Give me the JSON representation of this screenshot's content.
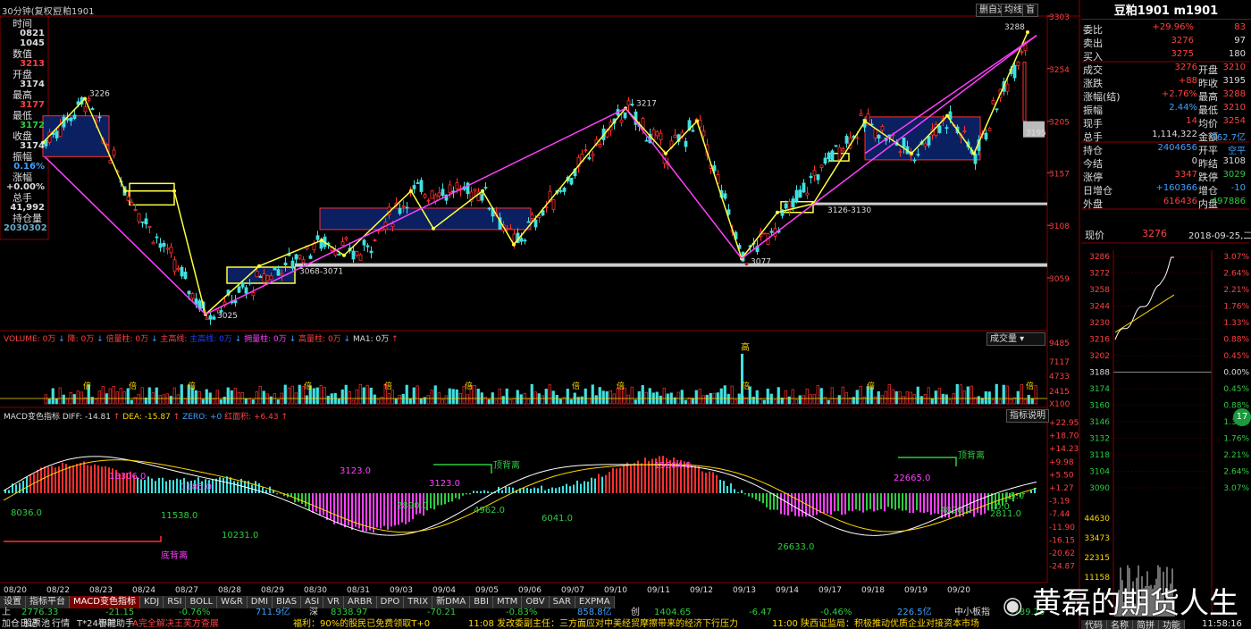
{
  "top_bar": {
    "period": "30分钟(复权)",
    "symbol": "豆粕1901",
    "buttons": [
      "删自选",
      "均线",
      "盲"
    ]
  },
  "left_panel": [
    {
      "label": "时间",
      "value": "0821",
      "vcolor": "#ddd"
    },
    {
      "label": "",
      "value": "1045",
      "vcolor": "#ddd"
    },
    {
      "label": "数值",
      "value": "3213",
      "vcolor": "#ff4040"
    },
    {
      "label": "开盘",
      "value": "3174",
      "vcolor": "#ddd"
    },
    {
      "label": "最高",
      "value": "3177",
      "vcolor": "#ff4040"
    },
    {
      "label": "最低",
      "value": "3172",
      "vcolor": "#2ecc40"
    },
    {
      "label": "收盘",
      "value": "3174",
      "vcolor": "#ddd"
    },
    {
      "label": "振幅",
      "value": "0.16%",
      "vcolor": "#40a0ff"
    },
    {
      "label": "涨幅",
      "value": "+0.00%",
      "vcolor": "#ddd"
    },
    {
      "label": "总手",
      "value": "41,992",
      "vcolor": "#ddd"
    },
    {
      "label": "持仓量",
      "value": "2030302",
      "vcolor": "#6ac"
    }
  ],
  "price_axis": [
    "3303",
    "3254",
    "3205",
    "3157",
    "3108",
    "3059"
  ],
  "annotations": {
    "p3226": "3226",
    "p3025": "3025",
    "p3217": "3217",
    "p3077": "3077",
    "p3288": "3288",
    "z1": "3068-3071",
    "z2": "3126-3130",
    "p3195": "3195"
  },
  "volume_panel": {
    "header": [
      {
        "t": "VOLUME: 0万",
        "c": "#ff4040"
      },
      {
        "t": "↓",
        "c": "#40a0ff"
      },
      {
        "t": "降: 0万",
        "c": "#ff4040"
      },
      {
        "t": "↓",
        "c": "#40a0ff"
      },
      {
        "t": "倍量柱: 0万",
        "c": "#ff4040"
      },
      {
        "t": "↓",
        "c": "#40a0ff"
      },
      {
        "t": "主高线: ",
        "c": "#ff4040"
      },
      {
        "t": "主高线: 0万",
        "c": "#2040ff"
      },
      {
        "t": "↓",
        "c": "#40a0ff"
      },
      {
        "t": "拥量柱: 0万",
        "c": "#ff40ff"
      },
      {
        "t": "↓",
        "c": "#40a0ff"
      },
      {
        "t": "高量柱: 0万",
        "c": "#ff4040"
      },
      {
        "t": "↓",
        "c": "#40a0ff"
      },
      {
        "t": "MA1: 0万",
        "c": "#ddd"
      },
      {
        "t": "↑",
        "c": "#ff4040"
      }
    ],
    "dropdown": "成交量",
    "axis": [
      "9485",
      "7117",
      "4733",
      "2415",
      "X100"
    ],
    "label_bei": "倍",
    "label_gao": "高"
  },
  "macd_panel": {
    "header": [
      {
        "t": "MACD变色指标",
        "c": "#ddd"
      },
      {
        "t": "DIFF: -14.81",
        "c": "#ddd"
      },
      {
        "t": "↑",
        "c": "#ff4040"
      },
      {
        "t": "DEA: -15.87",
        "c": "#ffd700"
      },
      {
        "t": "↑",
        "c": "#ff4040"
      },
      {
        "t": "ZERO: +0",
        "c": "#40a0ff"
      },
      {
        "t": "红面积: +6.43",
        "c": "#ff4040"
      },
      {
        "t": "↑",
        "c": "#ff4040"
      }
    ],
    "indicator_btn": "指标说明",
    "axis": [
      "+22.95",
      "+18.70",
      "+14.23",
      "+9.98",
      "+5.50",
      "+1.27",
      "-3.19",
      "-7.44",
      "-11.90",
      "-16.15",
      "-20.62",
      "-24.87"
    ],
    "labels": {
      "a8036": "8036.0",
      "a18306": "18306.0",
      "a1185": "1185.0",
      "a11538": "11538.0",
      "a10231": "10231.0",
      "a_di": "底背离",
      "a3123": "3123.0",
      "a2890": "2890.0",
      "a4962": "4962.0",
      "a6041": "6041.0",
      "a_ding1": "顶背离",
      "a15604": "15604.0",
      "a26633": "26633.0",
      "a22665": "22665.0",
      "a4820": "4820.0",
      "a2811": "2811.0",
      "a_ding2": "顶背离",
      "a15": "15.0",
      "a0": "0.0",
      "a3123b": "3123.0"
    }
  },
  "date_axis": [
    "08/20",
    "08/22",
    "08/23",
    "08/24",
    "08/27",
    "08/28",
    "08/29",
    "08/30",
    "08/31",
    "09/03",
    "09/04",
    "09/05",
    "09/06",
    "09/07",
    "09/10",
    "09/11",
    "09/12",
    "09/13",
    "09/14",
    "09/17",
    "09/18",
    "09/19",
    "09/20"
  ],
  "bottom_tabs": [
    "设置",
    "指标平台",
    "MACD变色指标",
    "KDJ",
    "RSI",
    "BOLL",
    "W&R",
    "DMI",
    "BIAS",
    "ASI",
    "VR",
    "ARBR",
    "DPO",
    "TRIX",
    "新DMA",
    "BBI",
    "MTM",
    "OBV",
    "SAR",
    "EXPMA"
  ],
  "bottom_active_tab": "MACD变色指标",
  "index_bar": [
    {
      "t": "上",
      "c": "#ddd"
    },
    {
      "t": "2776.33",
      "c": "#2ecc40"
    },
    {
      "t": "-21.15",
      "c": "#2ecc40"
    },
    {
      "t": "-0.76%",
      "c": "#2ecc40"
    },
    {
      "t": "711.9亿",
      "c": "#40a0ff"
    },
    {
      "t": "深",
      "c": "#ddd"
    },
    {
      "t": "8338.97",
      "c": "#2ecc40"
    },
    {
      "t": "-70.21",
      "c": "#2ecc40"
    },
    {
      "t": "-0.83%",
      "c": "#2ecc40"
    },
    {
      "t": "858.8亿",
      "c": "#40a0ff"
    },
    {
      "t": "创",
      "c": "#ddd"
    },
    {
      "t": "1404.65",
      "c": "#2ecc40"
    },
    {
      "t": "-6.47",
      "c": "#2ecc40"
    },
    {
      "t": "-0.46%",
      "c": "#2ecc40"
    },
    {
      "t": "226.5亿",
      "c": "#40a0ff"
    },
    {
      "t": "中小板指",
      "c": "#ddd"
    },
    {
      "t": "5789.75",
      "c": "#2ecc40"
    }
  ],
  "status_bar": [
    {
      "t": "加仓日记",
      "c": "#ddd"
    },
    {
      "t": "股票池",
      "c": "#ddd"
    },
    {
      "t": "行情",
      "c": "#ddd"
    },
    {
      "t": "T*24小时",
      "c": "#ddd"
    },
    {
      "t": "智能助手",
      "c": "#ddd"
    },
    {
      "t": "A完全解决王芙方查展",
      "c": "#ff4040"
    },
    {
      "t": "福利：90%的股民已免费领取T+0",
      "c": "#ffd700"
    },
    {
      "t": "11:08 发改委副主任：三方面应对中美经贸摩擦带来的经济下行压力",
      "c": "#ffd700"
    },
    {
      "t": "11:00 陕西证监局：积极推动优质企业对接资本市场",
      "c": "#ffd700"
    },
    {
      "t": "11:58:16",
      "c": "#ddd"
    }
  ],
  "right_panel": {
    "title": "豆粕1901 m1901",
    "rows": [
      {
        "l": "委比",
        "v": "+29.96%",
        "vc": "#ff4040",
        "r": "83",
        "rc": "#ff4040"
      },
      {
        "l": "卖出",
        "v": "3276",
        "vc": "#ff4040",
        "r": "97",
        "rc": "#ddd"
      },
      {
        "l": "买入",
        "v": "3275",
        "vc": "#ff4040",
        "r": "180",
        "rc": "#ddd"
      },
      {
        "l": "成交",
        "v": "3276",
        "vc": "#ff4040",
        "m": "开盘",
        "r": "3210",
        "rc": "#ff4040"
      },
      {
        "l": "涨跌",
        "v": "+88",
        "vc": "#ff4040",
        "m": "昨收",
        "r": "3195",
        "rc": "#ddd"
      },
      {
        "l": "涨幅(结)",
        "v": "+2.76%",
        "vc": "#ff4040",
        "m": "最高",
        "r": "3288",
        "rc": "#ff4040"
      },
      {
        "l": "振幅",
        "v": "2.44%",
        "vc": "#40a0ff",
        "m": "最低",
        "r": "3210",
        "rc": "#ff4040"
      },
      {
        "l": "现手",
        "v": "14",
        "vc": "#ff4040",
        "m": "均价",
        "r": "3254",
        "rc": "#ff4040"
      },
      {
        "l": "总手",
        "v": "1,114,322",
        "vc": "#ddd",
        "m": "金额",
        "r": "362.7亿",
        "rc": "#40a0ff"
      },
      {
        "l": "持仓",
        "v": "2404656",
        "vc": "#40a0ff",
        "m": "开平",
        "r": "空平",
        "rc": "#40a0ff"
      },
      {
        "l": "今结",
        "v": "0",
        "vc": "#ddd",
        "m": "昨结",
        "r": "3108",
        "rc": "#ddd"
      },
      {
        "l": "涨停",
        "v": "3347",
        "vc": "#ff4040",
        "m": "跌停",
        "r": "3029",
        "rc": "#2ecc40"
      },
      {
        "l": "日增仓",
        "v": "+160366",
        "vc": "#40a0ff",
        "m": "增仓",
        "r": "-10",
        "rc": "#40a0ff"
      },
      {
        "l": "外盘",
        "v": "616436",
        "vc": "#ff4040",
        "m": "内盘",
        "r": "497886",
        "rc": "#2ecc40"
      }
    ],
    "now_label": "现价",
    "now_price": "3276",
    "date_text": "2018-09-25,二",
    "mini_left": [
      "3286",
      "3272",
      "3258",
      "3244",
      "3230",
      "3216",
      "3202",
      "3188",
      "3174",
      "3160",
      "3146",
      "3132",
      "3118",
      "3104",
      "3090"
    ],
    "mini_right": [
      "3.07%",
      "2.64%",
      "2.21%",
      "1.76%",
      "1.33%",
      "0.88%",
      "0.45%",
      "0.00%",
      "0.45%",
      "0.88%",
      "1.31%",
      "1.76%",
      "2.21%",
      "2.64%",
      "3.07%"
    ],
    "vol_axis": [
      "44630",
      "33473",
      "22315",
      "11158"
    ],
    "bottom_tabs": [
      "代码",
      "名称",
      "简拼",
      "功能"
    ],
    "side_badge": "17"
  },
  "watermark": "黄磊的期货人生",
  "watermark_icon": "weibo-icon"
}
